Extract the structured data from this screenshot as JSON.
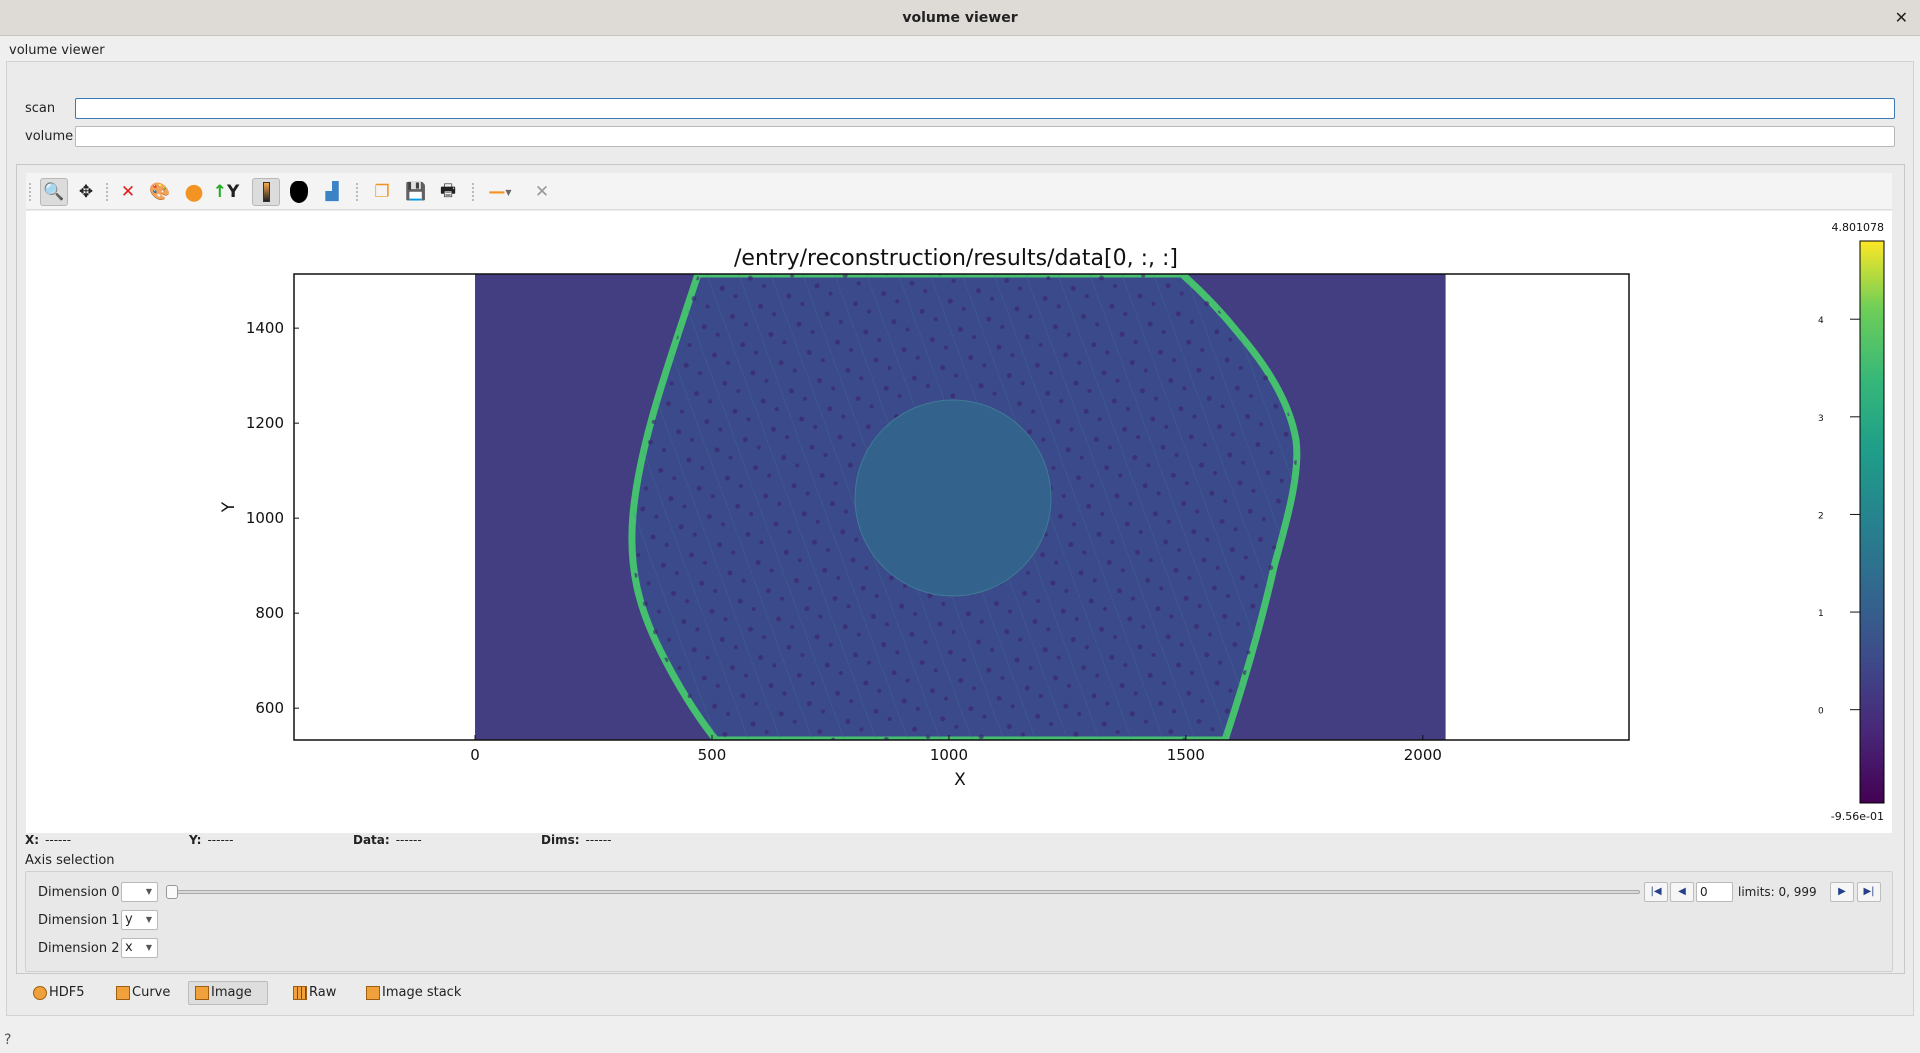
{
  "window": {
    "title": "volume viewer",
    "close_icon": "close-icon"
  },
  "panel_label": "volume viewer",
  "fields": {
    "scan_label": "scan",
    "scan_value": "",
    "volume_label": "volume",
    "volume_value": ""
  },
  "toolbar": {
    "icons": [
      "zoom-icon",
      "pan-icon",
      "reset-zoom-icon",
      "colormap-icon",
      "marker-icon",
      "y-axis-icon",
      "colorbar-icon",
      "mask-icon",
      "histogram-icon",
      "copy-icon",
      "save-icon",
      "print-icon",
      "line-style-icon",
      "crosshair-icon"
    ]
  },
  "status": {
    "x_label": "X:",
    "x_value": "------",
    "y_label": "Y:",
    "y_value": "------",
    "data_label": "Data:",
    "data_value": "------",
    "dims_label": "Dims:",
    "dims_value": "------"
  },
  "axis_selection": {
    "title": "Axis selection",
    "dims": [
      {
        "label": "Dimension 0",
        "value": ""
      },
      {
        "label": "Dimension 1",
        "value": "y"
      },
      {
        "label": "Dimension 2",
        "value": "x"
      }
    ],
    "frame_value": "0",
    "limits": "limits: 0, 999",
    "slider_fraction": 0
  },
  "tabs": [
    {
      "label": "HDF5"
    },
    {
      "label": "Curve"
    },
    {
      "label": "Image",
      "selected": true
    },
    {
      "label": "Raw"
    },
    {
      "label": "Image stack"
    }
  ],
  "help_icon": "?",
  "chart_data": {
    "type": "heatmap",
    "title": "/entry/reconstruction/results/data[0, :, :]",
    "xlabel": "X",
    "ylabel": "Y",
    "xlim": [
      -382,
      2435
    ],
    "ylim": [
      533,
      1514
    ],
    "image_extent": {
      "x": [
        0,
        2048
      ],
      "y": [
        533,
        1514
      ]
    },
    "xticks": [
      0,
      500,
      1000,
      1500,
      2000
    ],
    "yticks": [
      600,
      800,
      1000,
      1200,
      1400
    ],
    "colormap": "viridis",
    "colorbar": {
      "max_label": "4.801078",
      "min_label": "-9.56e-01",
      "min": -0.956,
      "max": 4.801078,
      "ticks": [
        0,
        1,
        2,
        3,
        4
      ]
    },
    "colors": {
      "background": "#433d82",
      "sample": "#3b4a8a",
      "rim": "#45c06f",
      "disc": "#33638d"
    }
  }
}
